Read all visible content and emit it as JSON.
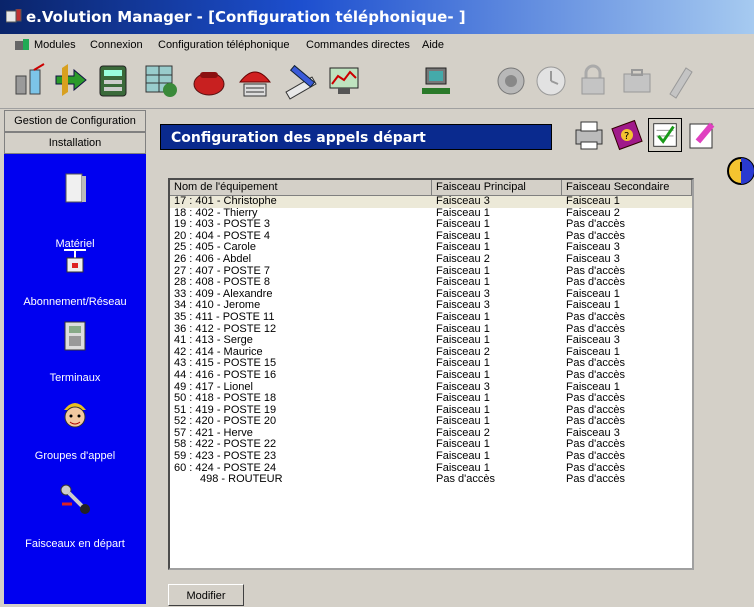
{
  "window": {
    "title": "e.Volution Manager - [Configuration téléphonique- ]"
  },
  "menu": [
    "Modules",
    "Connexion",
    "Configuration téléphonique",
    "Commandes directes",
    "Aide"
  ],
  "toolbar_icons": [
    "antenna-icon",
    "transfer-arrows-icon",
    "database-icon",
    "config-grid-icon",
    "phone-red-icon",
    "satellite-dish-icon",
    "pencil-ruler-icon",
    "monitor-chart-icon",
    "computer-phone-icon",
    "globe-icon",
    "clock-icon",
    "lock-icon",
    "briefcase-icon",
    "phone-handset-icon"
  ],
  "sidebar": {
    "header": "Gestion de Configuration",
    "section": "Installation",
    "items": [
      {
        "label": "Matériel",
        "icon": "hardware-box-icon"
      },
      {
        "label": "Abonnement/Réseau",
        "icon": "network-plug-icon"
      },
      {
        "label": "Terminaux",
        "icon": "telephone-icon"
      },
      {
        "label": "Groupes d'appel",
        "icon": "person-group-icon"
      },
      {
        "label": "Faisceaux en départ",
        "icon": "key-handset-icon"
      }
    ]
  },
  "panel": {
    "title": "Configuration des appels départ",
    "buttons": [
      "print-icon",
      "help-book-icon",
      "validate-check-icon",
      "edit-icon",
      "globe-clock-icon"
    ],
    "modify_label": "Modifier"
  },
  "table": {
    "headers": [
      "Nom de l'équipement",
      "Faisceau Principal",
      "Faisceau Secondaire"
    ],
    "rows": [
      [
        "17 : 401 - Christophe",
        "Faisceau 3",
        "Faisceau 1"
      ],
      [
        "18 : 402 - Thierry",
        "Faisceau 1",
        "Faisceau 2"
      ],
      [
        "19 : 403 - POSTE 3",
        "Faisceau 1",
        "Pas d'accès"
      ],
      [
        "20 : 404 - POSTE 4",
        "Faisceau 1",
        "Pas d'accès"
      ],
      [
        "25 : 405 - Carole",
        "Faisceau 1",
        "Faisceau 3"
      ],
      [
        "26 : 406 - Abdel",
        "Faisceau 2",
        "Faisceau 3"
      ],
      [
        "27 : 407 - POSTE 7",
        "Faisceau 1",
        "Pas d'accès"
      ],
      [
        "28 : 408 - POSTE 8",
        "Faisceau 1",
        "Pas d'accès"
      ],
      [
        "33 : 409 - Alexandre",
        "Faisceau 3",
        "Faisceau 1"
      ],
      [
        "34 : 410 - Jerome",
        "Faisceau 3",
        "Faisceau 1"
      ],
      [
        "35 : 411 - POSTE 11",
        "Faisceau 1",
        "Pas d'accès"
      ],
      [
        "36 : 412 - POSTE 12",
        "Faisceau 1",
        "Pas d'accès"
      ],
      [
        "41 : 413 - Serge",
        "Faisceau 1",
        "Faisceau 3"
      ],
      [
        "42 : 414 - Maurice",
        "Faisceau 2",
        "Faisceau 1"
      ],
      [
        "43 : 415 - POSTE 15",
        "Faisceau 1",
        "Pas d'accès"
      ],
      [
        "44 : 416 - POSTE 16",
        "Faisceau 1",
        "Pas d'accès"
      ],
      [
        "49 : 417 - Lionel",
        "Faisceau 3",
        "Faisceau 1"
      ],
      [
        "50 : 418 - POSTE 18",
        "Faisceau 1",
        "Pas d'accès"
      ],
      [
        "51 : 419 - POSTE 19",
        "Faisceau 1",
        "Pas d'accès"
      ],
      [
        "52 : 420 - POSTE 20",
        "Faisceau 1",
        "Pas d'accès"
      ],
      [
        "57 : 421 - Herve",
        "Faisceau 2",
        "Faisceau 3"
      ],
      [
        "58 : 422 - POSTE 22",
        "Faisceau 1",
        "Pas d'accès"
      ],
      [
        "59 : 423 - POSTE 23",
        "Faisceau 1",
        "Pas d'accès"
      ],
      [
        "60 : 424 - POSTE 24",
        "Faisceau 1",
        "Pas d'accès"
      ],
      [
        "498 - ROUTEUR",
        "Pas d'accès",
        "Pas d'accès"
      ]
    ]
  }
}
